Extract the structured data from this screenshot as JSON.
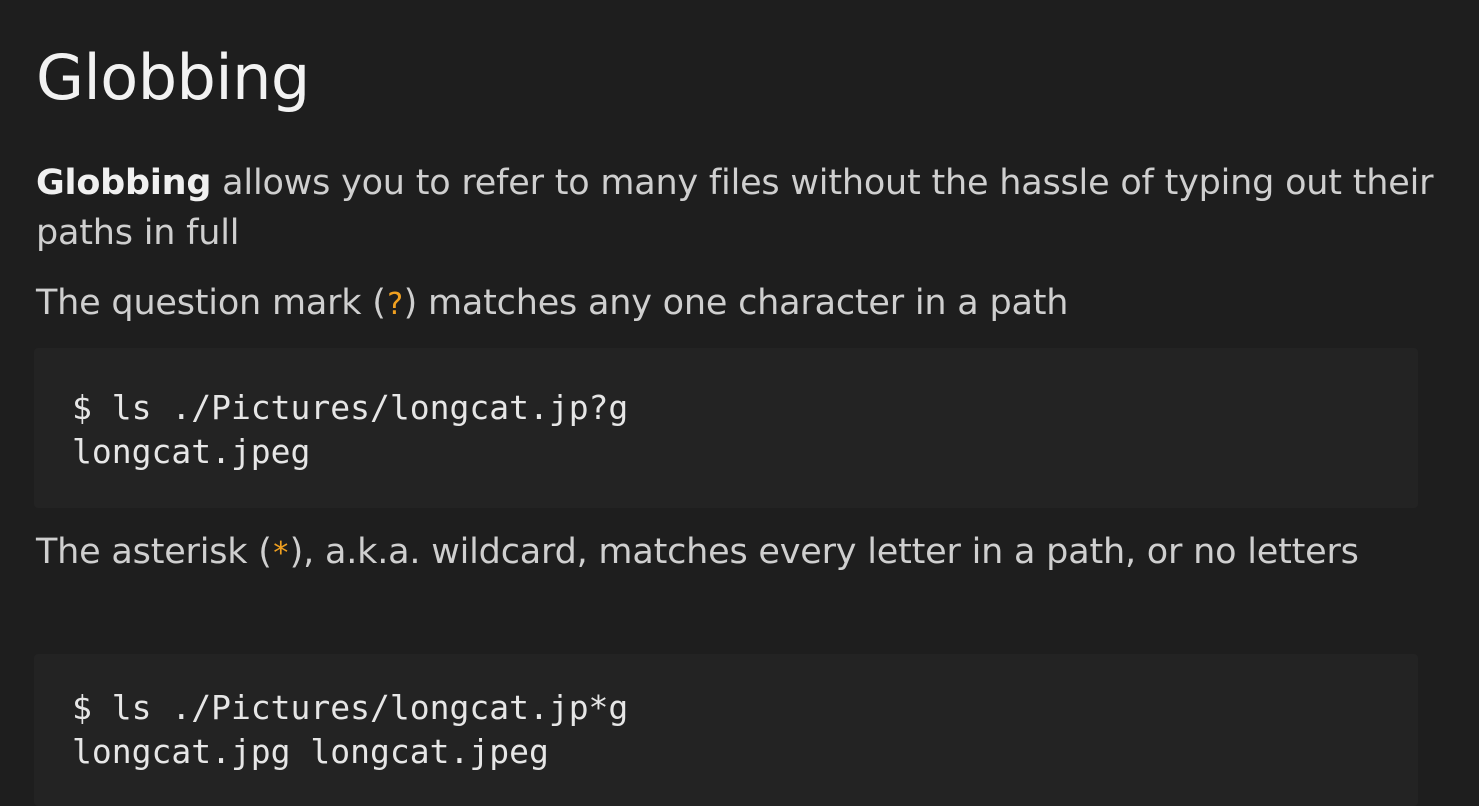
{
  "slide": {
    "title": "Globbing",
    "p1_strong": "Globbing",
    "p1_rest": " allows you to refer to many files without the hassle of typing out their paths in full",
    "p2_before": "The question mark (",
    "p2_code": "?",
    "p2_after": ") matches any one character in a path",
    "code1": {
      "line1": "$ ls ./Pictures/longcat.jp?g",
      "line2": "longcat.jpeg"
    },
    "p3_before": "The asterisk (",
    "p3_code": "*",
    "p3_after": "), a.k.a. wildcard, matches every letter in a path, or no letters",
    "code2": {
      "line1": "$ ls ./Pictures/longcat.jp*g",
      "line2": "longcat.jpg longcat.jpeg"
    }
  },
  "colors": {
    "background": "#1e1e1e",
    "code_background": "#232323",
    "accent_inline_code": "#f0a020"
  }
}
